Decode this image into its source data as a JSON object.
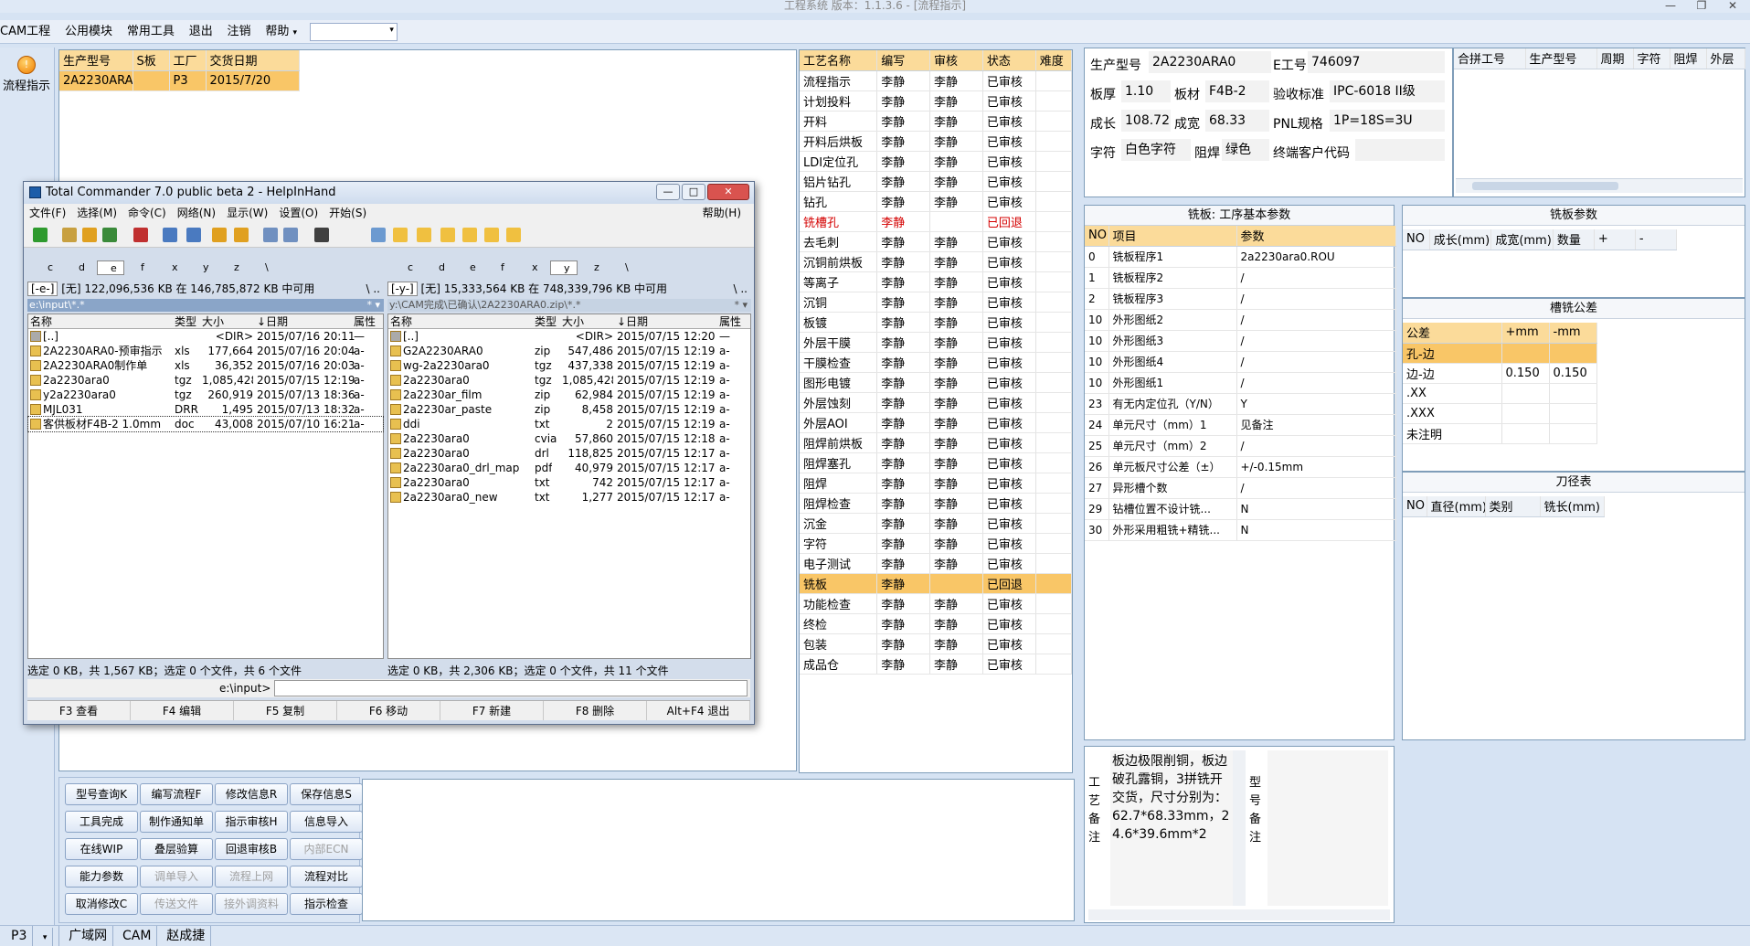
{
  "window": {
    "title": "工程系统   版本：1.1.3.6 - [流程指示]"
  },
  "menu": {
    "items": [
      "CAM工程",
      "公用模块",
      "常用工具",
      "退出",
      "注销",
      "帮助"
    ],
    "help_arrow": "▾"
  },
  "nav": {
    "flow_label": "流程指示"
  },
  "order": {
    "headers": [
      "生产型号",
      "S板",
      "工厂",
      "交货日期"
    ],
    "rows": [
      [
        "2A2230ARA0",
        "",
        "P3",
        "2015/7/20"
      ]
    ]
  },
  "process": {
    "headers": [
      "工艺名称",
      "编写",
      "审核",
      "状态",
      "难度"
    ],
    "rows": [
      [
        "流程指示",
        "李静",
        "李静",
        "已审核",
        ""
      ],
      [
        "计划投料",
        "李静",
        "李静",
        "已审核",
        ""
      ],
      [
        "开料",
        "李静",
        "李静",
        "已审核",
        ""
      ],
      [
        "开料后烘板",
        "李静",
        "李静",
        "已审核",
        ""
      ],
      [
        "LDI定位孔",
        "李静",
        "李静",
        "已审核",
        ""
      ],
      [
        "铝片钻孔",
        "李静",
        "李静",
        "已审核",
        ""
      ],
      [
        "钻孔",
        "李静",
        "李静",
        "已审核",
        ""
      ],
      [
        "铣槽孔",
        "李静",
        "",
        "已回退",
        ""
      ],
      [
        "去毛刺",
        "李静",
        "李静",
        "已审核",
        ""
      ],
      [
        "沉铜前烘板",
        "李静",
        "李静",
        "已审核",
        ""
      ],
      [
        "等离子",
        "李静",
        "李静",
        "已审核",
        ""
      ],
      [
        "沉铜",
        "李静",
        "李静",
        "已审核",
        ""
      ],
      [
        "板镀",
        "李静",
        "李静",
        "已审核",
        ""
      ],
      [
        "外层干膜",
        "李静",
        "李静",
        "已审核",
        ""
      ],
      [
        "干膜检查",
        "李静",
        "李静",
        "已审核",
        ""
      ],
      [
        "图形电镀",
        "李静",
        "李静",
        "已审核",
        ""
      ],
      [
        "外层蚀刻",
        "李静",
        "李静",
        "已审核",
        ""
      ],
      [
        "外层AOI",
        "李静",
        "李静",
        "已审核",
        ""
      ],
      [
        "阻焊前烘板",
        "李静",
        "李静",
        "已审核",
        ""
      ],
      [
        "阻焊塞孔",
        "李静",
        "李静",
        "已审核",
        ""
      ],
      [
        "阻焊",
        "李静",
        "李静",
        "已审核",
        ""
      ],
      [
        "阻焊检查",
        "李静",
        "李静",
        "已审核",
        ""
      ],
      [
        "沉金",
        "李静",
        "李静",
        "已审核",
        ""
      ],
      [
        "字符",
        "李静",
        "李静",
        "已审核",
        ""
      ],
      [
        "电子测试",
        "李静",
        "李静",
        "已审核",
        ""
      ],
      [
        "铣板",
        "李静",
        "",
        "已回退",
        ""
      ],
      [
        "功能检查",
        "李静",
        "李静",
        "已审核",
        ""
      ],
      [
        "终检",
        "李静",
        "李静",
        "已审核",
        ""
      ],
      [
        "包装",
        "李静",
        "李静",
        "已审核",
        ""
      ],
      [
        "成品仓",
        "李静",
        "李静",
        "已审核",
        ""
      ]
    ]
  },
  "info": {
    "model_label": "生产型号",
    "model": "2A2230ARA0",
    "e_label": "E工号",
    "e_no": "746097",
    "thick_label": "板厚",
    "thick": "1.10",
    "mat_label": "板材",
    "mat": "F4B-2",
    "std_label": "验收标准",
    "std": "IPC-6018 II级",
    "len_label": "成长",
    "len": "108.72",
    "wid_label": "成宽",
    "wid": "68.33",
    "pnl_label": "PNL规格",
    "pnl": "1P=18S=3U",
    "char_label": "字符",
    "char": "白色字符",
    "mask_label": "阻焊",
    "mask": "绿色",
    "cust_label": "终端客户代码",
    "cust": ""
  },
  "merge": {
    "headers": [
      "合拼工号",
      "生产型号",
      "周期",
      "字符",
      "阻焊",
      "外层"
    ]
  },
  "mill": {
    "title": "铣板: 工序基本参数",
    "headers": [
      "NO",
      "项目",
      "参数"
    ],
    "rows": [
      [
        "0",
        "铣板程序1",
        "2a2230ara0.ROU"
      ],
      [
        "1",
        "铣板程序2",
        "/"
      ],
      [
        "2",
        "铣板程序3",
        "/"
      ],
      [
        "10",
        "外形图纸2",
        "/"
      ],
      [
        "10",
        "外形图纸3",
        "/"
      ],
      [
        "10",
        "外形图纸4",
        "/"
      ],
      [
        "10",
        "外形图纸1",
        "/"
      ],
      [
        "23",
        "有无内定位孔（Y/N）",
        "Y"
      ],
      [
        "24",
        "单元尺寸（mm）1",
        "见备注"
      ],
      [
        "25",
        "单元尺寸（mm）2",
        "/"
      ],
      [
        "26",
        "单元板尺寸公差（±）",
        "+/-0.15mm"
      ],
      [
        "27",
        "异形槽个数",
        "/"
      ],
      [
        "29",
        "钻槽位置不设计铣...",
        "N"
      ],
      [
        "30",
        "外形采用粗铣+精铣...",
        "N"
      ]
    ]
  },
  "mill_params": {
    "title": "铣板参数",
    "headers": [
      "NO",
      "成长(mm)",
      "成宽(mm)",
      "数量",
      "+",
      "-"
    ]
  },
  "tolerance": {
    "title": "槽铣公差",
    "headers": [
      "公差",
      "+mm",
      "-mm"
    ],
    "rows": [
      [
        "孔-边",
        "",
        ""
      ],
      [
        "边-边",
        "0.150",
        "0.150"
      ],
      [
        ".XX",
        "",
        ""
      ],
      [
        ".XXX",
        "",
        ""
      ],
      [
        "未注明",
        "",
        ""
      ]
    ]
  },
  "tools": {
    "title": "刀径表",
    "headers": [
      "NO",
      "直径(mm)",
      "类别",
      "铣长(mm)"
    ]
  },
  "remarks": {
    "proc_label": "工艺备注",
    "proc_text": "板边极限削铜，板边破孔露铜，3拼铣开交货，尺寸分别为：62.7*68.33mm，24.6*39.6mm*2",
    "model_label": "型号备注",
    "model_text": ""
  },
  "buttons": [
    [
      "型号查询K",
      "编写流程F",
      "修改信息R",
      "保存信息S"
    ],
    [
      "工具完成",
      "制作通知单",
      "指示审核H",
      "信息导入"
    ],
    [
      "在线WIP",
      "叠层验算",
      "回退审核B",
      "内部ECN"
    ],
    [
      "能力参数",
      "调单导入",
      "流程上网",
      "流程对比"
    ],
    [
      "取消修改C",
      "传送文件",
      "接外调资料",
      "指示检查"
    ]
  ],
  "tc": {
    "title": "Total Commander 7.0 public beta 2 - HelpInHand",
    "menu": [
      "文件(F)",
      "选择(M)",
      "命令(C)",
      "网络(N)",
      "显示(W)",
      "设置(O)",
      "开始(S)"
    ],
    "help": "帮助(H)",
    "left": {
      "drive": "[-e-]",
      "free": "[无]  122,096,536 KB 在 146,785,872 KB 中可用",
      "path": "e:\\input\\*.*",
      "headers": [
        "名称",
        "类型",
        "大小",
        "↓日期",
        "属性"
      ],
      "rows": [
        [
          "[..]",
          "",
          "<DIR>",
          "2015/07/16 20:11",
          "—"
        ],
        [
          "2A2230ARA0-预审指示",
          "xls",
          "177,664",
          "2015/07/16 20:04",
          "a-"
        ],
        [
          "2A2230ARA0制作单",
          "xls",
          "36,352",
          "2015/07/16 20:03",
          "a-"
        ],
        [
          "2a2230ara0",
          "tgz",
          "1,085,428",
          "2015/07/15 12:19",
          "a-"
        ],
        [
          "y2a2230ara0",
          "tgz",
          "260,919",
          "2015/07/13 18:36",
          "a-"
        ],
        [
          "MJL031",
          "DRR",
          "1,495",
          "2015/07/13 18:32",
          "a-"
        ],
        [
          "客供板材F4B-2 1.0mm",
          "doc",
          "43,008",
          "2015/07/10 16:21",
          "a-"
        ]
      ],
      "status": "选定 0 KB，共 1,567 KB；选定 0 个文件，共 6 个文件"
    },
    "right": {
      "drive": "[-y-]",
      "free": "[无]  15,333,564 KB 在 748,339,796 KB 中可用",
      "path": "y:\\CAM完成\\已确认\\2A2230ARA0.zip\\*.*",
      "headers": [
        "名称",
        "类型",
        "大小",
        "↓日期",
        "属性"
      ],
      "rows": [
        [
          "[..]",
          "",
          "<DIR>",
          "2015/07/15 12:20",
          "—"
        ],
        [
          "G2A2230ARA0",
          "zip",
          "547,486",
          "2015/07/15 12:19",
          "a-"
        ],
        [
          "wg-2a2230ara0",
          "tgz",
          "437,338",
          "2015/07/15 12:19",
          "a-"
        ],
        [
          "2a2230ara0",
          "tgz",
          "1,085,428",
          "2015/07/15 12:19",
          "a-"
        ],
        [
          "2a2230ar_film",
          "zip",
          "62,984",
          "2015/07/15 12:19",
          "a-"
        ],
        [
          "2a2230ar_paste",
          "zip",
          "8,458",
          "2015/07/15 12:19",
          "a-"
        ],
        [
          "ddi",
          "txt",
          "2",
          "2015/07/15 12:19",
          "a-"
        ],
        [
          "2a2230ara0",
          "cvia",
          "57,860",
          "2015/07/15 12:18",
          "a-"
        ],
        [
          "2a2230ara0",
          "drl",
          "118,825",
          "2015/07/15 12:17",
          "a-"
        ],
        [
          "2a2230ara0_drl_map",
          "pdf",
          "40,979",
          "2015/07/15 12:17",
          "a-"
        ],
        [
          "2a2230ara0",
          "txt",
          "742",
          "2015/07/15 12:17",
          "a-"
        ],
        [
          "2a2230ara0_new",
          "txt",
          "1,277",
          "2015/07/15 12:17",
          "a-"
        ]
      ],
      "status": "选定 0 KB，共 2,306 KB；选定 0 个文件，共 11 个文件"
    },
    "cmd_label": "e:\\input>",
    "fkeys": [
      "F3 查看",
      "F4 编辑",
      "F5 复制",
      "F6 移动",
      "F7 新建",
      "F8 删除",
      "Alt+F4 退出"
    ],
    "drives_left": [
      "c",
      "d",
      "e",
      "f",
      "x",
      "y",
      "z",
      "\\"
    ],
    "drives_right": [
      "c",
      "d",
      "e",
      "f",
      "x",
      "y",
      "z",
      "\\"
    ]
  },
  "statusbar": [
    "P3",
    "广域网",
    "CAM",
    "赵成捷"
  ]
}
